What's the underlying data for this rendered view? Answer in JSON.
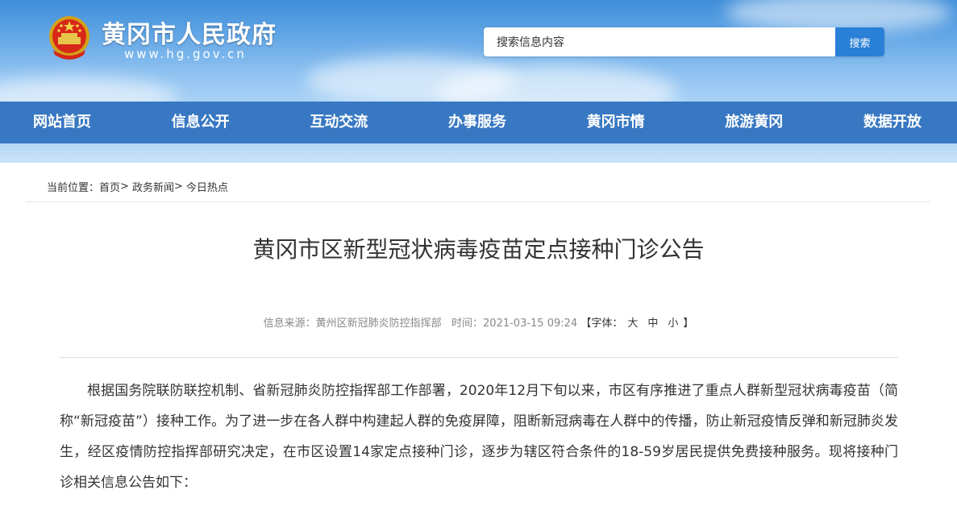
{
  "header": {
    "site_title": "黄冈市人民政府",
    "site_url": "www.hg.gov.cn",
    "emblem_icon": "national-emblem-icon",
    "search": {
      "placeholder": "搜索信息内容",
      "value": "搜索信息内容",
      "button_label": "搜索"
    }
  },
  "nav": {
    "items": [
      {
        "label": "网站首页"
      },
      {
        "label": "信息公开"
      },
      {
        "label": "互动交流"
      },
      {
        "label": "办事服务"
      },
      {
        "label": "黄冈市情"
      },
      {
        "label": "旅游黄冈"
      },
      {
        "label": "数据开放"
      }
    ]
  },
  "breadcrumb": {
    "prefix": "当前位置：",
    "items": [
      {
        "label": "首页"
      },
      {
        "label": "政务新闻"
      },
      {
        "label": "今日热点"
      }
    ],
    "separator": ">"
  },
  "article": {
    "title": "黄冈市区新型冠状病毒疫苗定点接种门诊公告",
    "meta": {
      "source_label": "信息来源：",
      "source_value": "黄州区新冠肺炎防控指挥部",
      "time_label": "时间：",
      "time_value": "2021-03-15 09:24",
      "font_open": "【字体：",
      "font_large": "大",
      "font_medium": "中",
      "font_small": "小",
      "font_close": "】"
    },
    "body": "根据国务院联防联控机制、省新冠肺炎防控指挥部工作部署，2020年12月下旬以来，市区有序推进了重点人群新型冠状病毒疫苗（简称“新冠疫苗”）接种工作。为了进一步在各人群中构建起人群的免疫屏障，阻断新冠病毒在人群中的传播，防止新冠疫情反弹和新冠肺炎发生，经区疫情防控指挥部研究决定，在市区设置14家定点接种门诊，逐步为辖区符合条件的18-59岁居民提供免费接种服务。现将接种门诊相关信息公告如下："
  },
  "colors": {
    "header_blue": "#3f8ed9",
    "nav_blue": "#3878c2",
    "search_button": "#2a7fd6"
  }
}
